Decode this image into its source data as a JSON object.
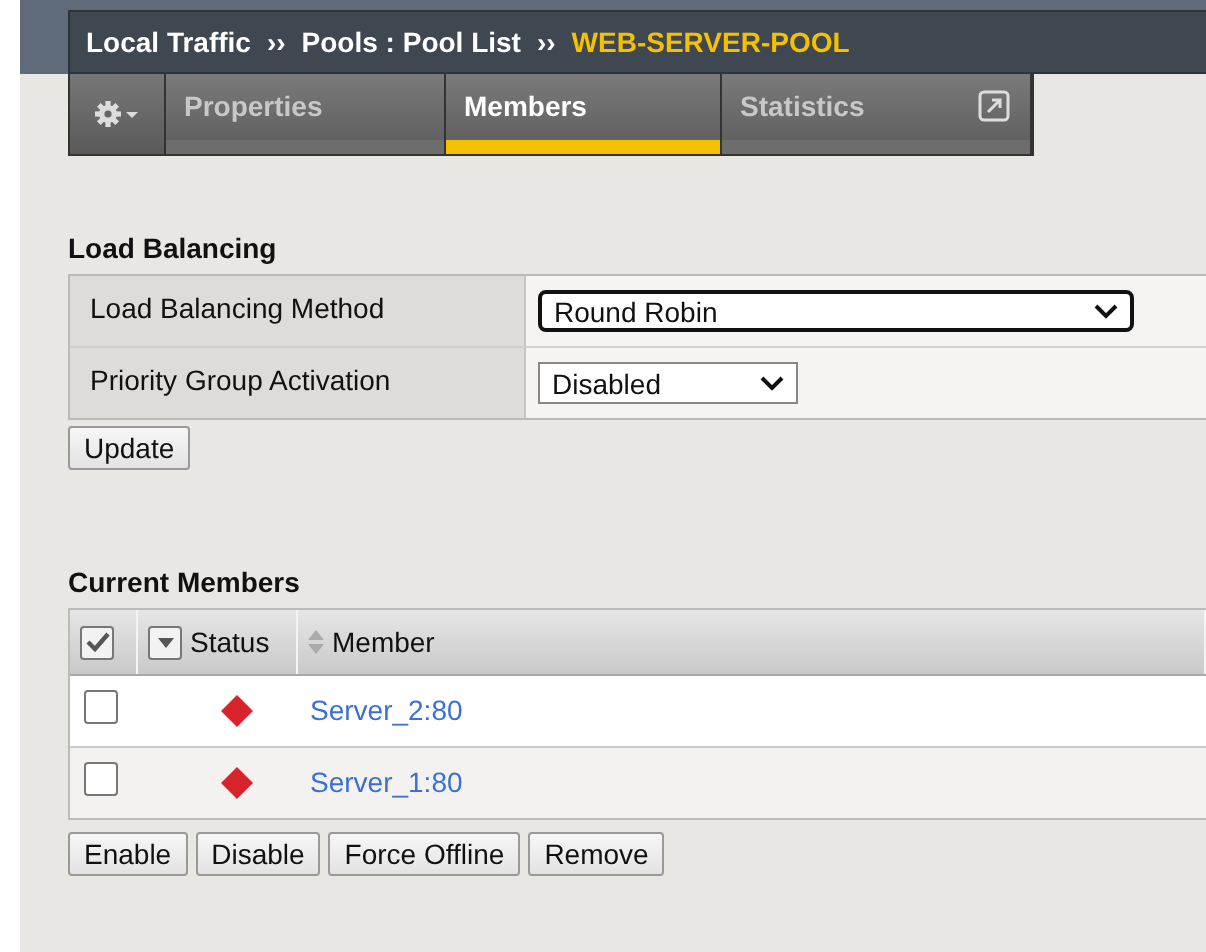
{
  "breadcrumb": {
    "items": [
      "Local Traffic",
      "Pools : Pool List"
    ],
    "separator": "››",
    "current": "WEB-SERVER-POOL"
  },
  "tabs": [
    {
      "label": "Properties",
      "selected": false
    },
    {
      "label": "Members",
      "selected": true
    },
    {
      "label": "Statistics",
      "selected": false
    }
  ],
  "load_balancing": {
    "title": "Load Balancing",
    "rows": [
      {
        "label": "Load Balancing Method",
        "value": "Round Robin",
        "focused": true
      },
      {
        "label": "Priority Group Activation",
        "value": "Disabled",
        "focused": false
      }
    ],
    "button": "Update"
  },
  "members": {
    "title": "Current Members",
    "select_all_checked": true,
    "columns": [
      "Status",
      "Member"
    ],
    "rows": [
      {
        "checked": false,
        "color": "#d8232a",
        "member": "Server_2:80"
      },
      {
        "checked": false,
        "color": "#d8232a",
        "member": "Server_1:80"
      }
    ],
    "buttons": [
      "Enable",
      "Disable",
      "Force Offline",
      "Remove"
    ]
  }
}
